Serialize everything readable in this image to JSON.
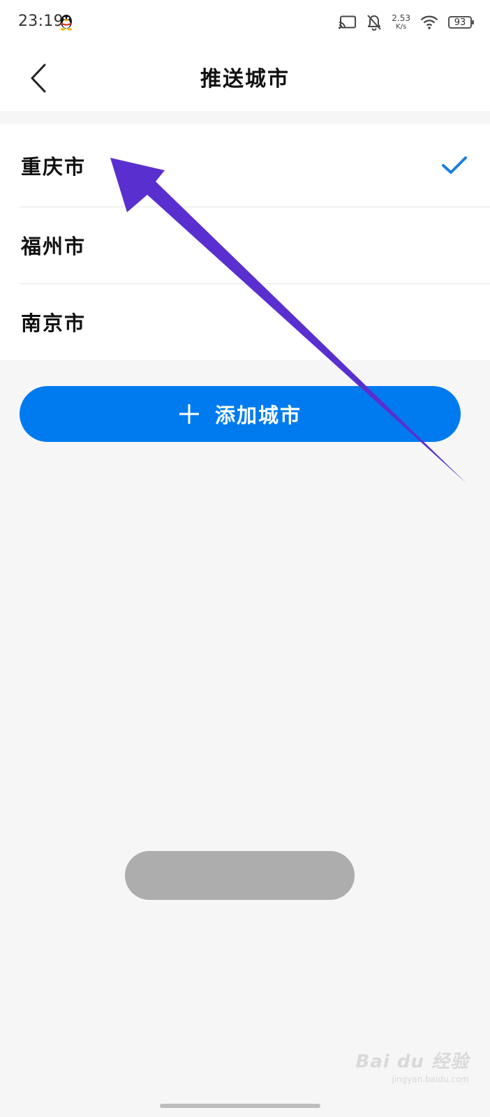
{
  "status_bar": {
    "time": "23:19",
    "net_speed_value": "2.53",
    "net_speed_unit": "K/s",
    "battery": "93",
    "icons": [
      "qq-icon",
      "cast-icon",
      "bell-off-icon",
      "wifi-icon",
      "battery-icon"
    ]
  },
  "header": {
    "title": "推送城市",
    "back_icon": "chevron-left-icon"
  },
  "cities": [
    {
      "name": "重庆市",
      "selected": true
    },
    {
      "name": "福州市",
      "selected": false
    },
    {
      "name": "南京市",
      "selected": false
    }
  ],
  "add_button": {
    "label": "添加城市",
    "icon": "plus-icon"
  },
  "annotation": {
    "type": "arrow",
    "color": "#5a2fcf",
    "points_to": "重庆市"
  },
  "watermark": {
    "brand": "Bai du 经验",
    "site": "jingyan.baidu.com"
  },
  "colors": {
    "accent": "#007bef",
    "check": "#1a7fe0",
    "background": "#f6f6f6",
    "annotation": "#5a2fcf"
  }
}
